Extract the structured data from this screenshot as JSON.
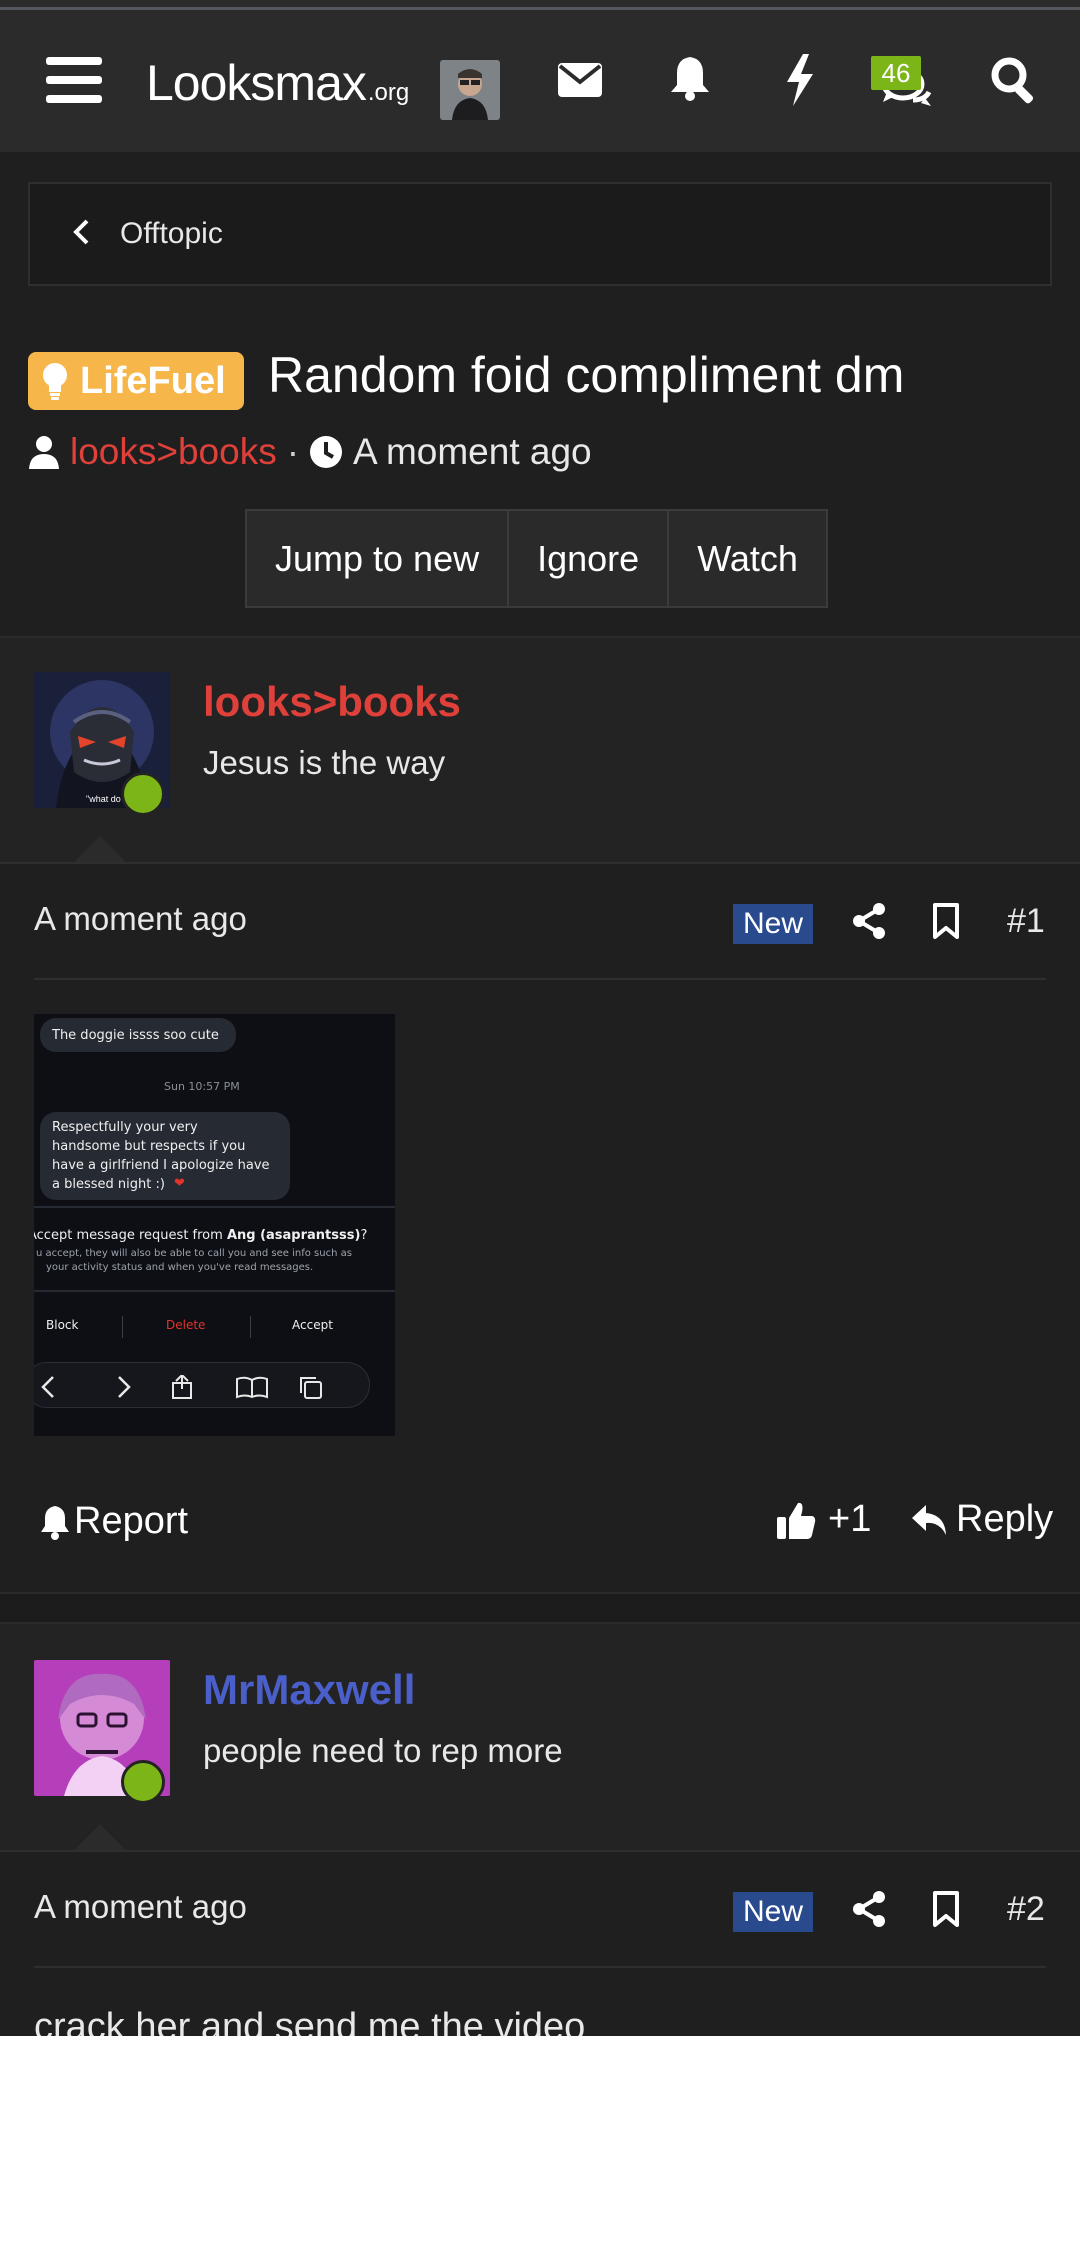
{
  "header": {
    "logo_text": "Looksmax",
    "logo_suffix": ".org",
    "icons": [
      "menu-icon",
      "envelope-icon",
      "bell-icon",
      "bolt-icon",
      "chat-icon",
      "search-icon"
    ],
    "conversations_badge": "46"
  },
  "breadcrumb": {
    "label": "Offtopic"
  },
  "thread": {
    "prefix": "LifeFuel",
    "prefix_color": "#f7b64a",
    "title": "Random foid compliment dm",
    "author": "looks>books",
    "separator": "·",
    "time": "A moment ago"
  },
  "actions": {
    "jump_to_new": "Jump to new",
    "ignore": "Ignore",
    "watch": "Watch"
  },
  "posts": [
    {
      "username": "looks>books",
      "username_color": "#e0403a",
      "user_title": "Jesus is the way",
      "time": "A moment ago",
      "badge": "New",
      "number": "#1",
      "report": "Report",
      "reaction": "+1",
      "reply": "Reply",
      "attachment": {
        "bubble1": "The doggie issss soo cute",
        "timestamp": "Sun 10:57 PM",
        "bubble2_lines": [
          "Respectfully your very",
          "handsome but respects if you",
          "have a girlfriend I apologize have",
          "a blessed night :)"
        ],
        "request_prefix": "Accept message request from ",
        "request_name": "Ang (asaprantsss)",
        "request_suffix": "?",
        "request_info_lines": [
          "u accept, they will also be able to call you and see info such as",
          "your activity status and when you've read messages."
        ],
        "block": "Block",
        "delete": "Delete",
        "accept": "Accept",
        "watermark": "\"what do"
      }
    },
    {
      "username": "MrMaxwell",
      "username_color": "#4a5fc9",
      "user_title": "people need to rep more",
      "time": "A moment ago",
      "badge": "New",
      "number": "#2",
      "body": "crack her and send me the video"
    }
  ],
  "colors": {
    "background": "#1f1f1f",
    "header": "#2b2b2b",
    "online": "#7cb518",
    "new_badge": "#2a4a8e",
    "author_red": "#e0403a",
    "user_blue": "#4a5fc9"
  }
}
